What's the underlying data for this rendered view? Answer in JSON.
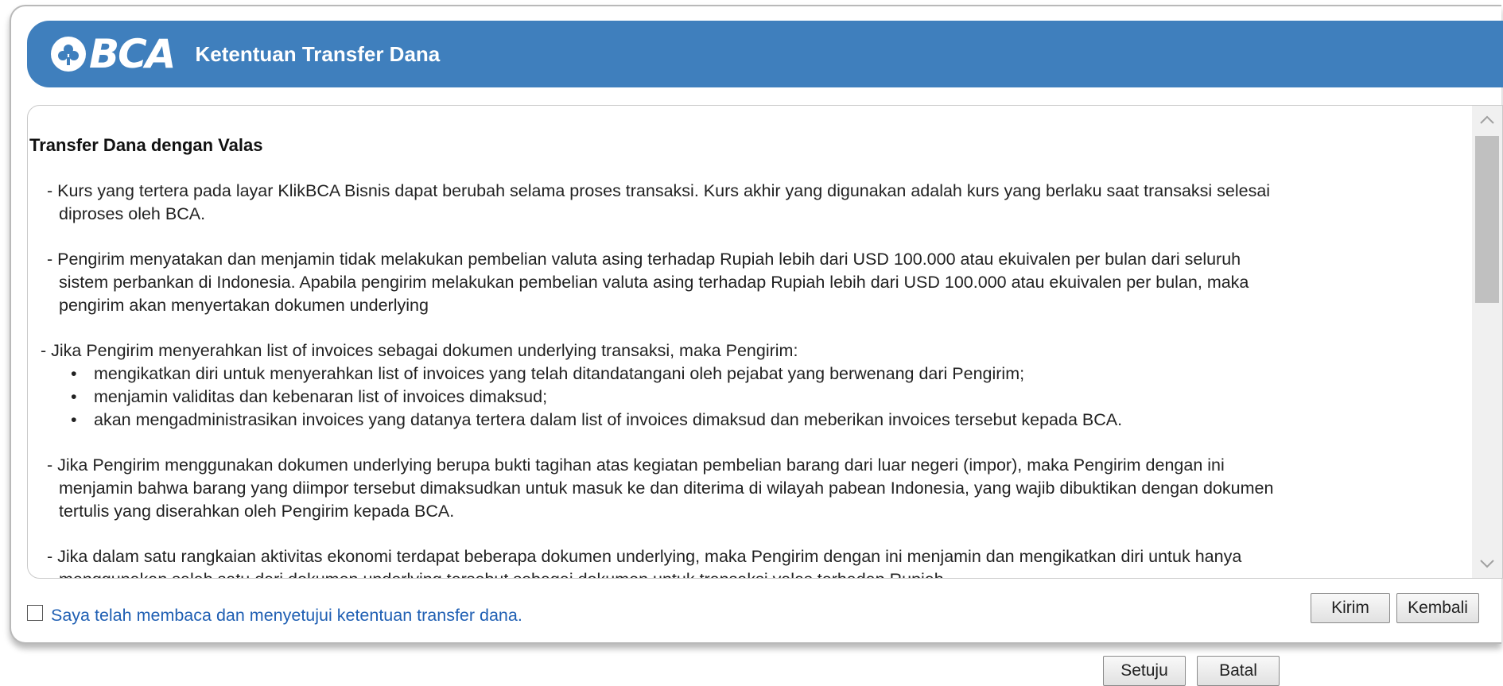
{
  "header": {
    "logo_text": "BCA",
    "title": "Ketentuan Transfer Dana",
    "background_color": "#3f7fbd"
  },
  "content": {
    "section_title": "Transfer Dana dengan Valas",
    "para1": [
      "- Kurs yang tertera pada layar KlikBCA Bisnis dapat berubah selama proses transaksi. Kurs akhir yang digunakan adalah kurs yang berlaku saat transaksi selesai",
      "diproses oleh BCA."
    ],
    "para2": [
      "- Pengirim menyatakan dan menjamin tidak melakukan pembelian valuta asing terhadap Rupiah lebih dari USD 100.000 atau ekuivalen per bulan dari seluruh",
      "sistem perbankan di Indonesia. Apabila pengirim melakukan pembelian valuta asing terhadap Rupiah lebih dari USD 100.000 atau ekuivalen per bulan, maka",
      "pengirim akan menyertakan dokumen underlying"
    ],
    "para3_intro": "- Jika Pengirim menyerahkan list of invoices sebagai dokumen underlying transaksi, maka Pengirim:",
    "para3_bullets": [
      "mengikatkan diri untuk menyerahkan list of invoices yang telah ditandatangani oleh pejabat yang berwenang dari Pengirim;",
      "menjamin validitas dan kebenaran list of invoices dimaksud;",
      "akan mengadministrasikan invoices yang datanya tertera dalam list of invoices dimaksud dan meberikan invoices tersebut kepada BCA."
    ],
    "para4": [
      "- Jika Pengirim menggunakan dokumen underlying berupa bukti tagihan atas kegiatan pembelian barang dari luar negeri (impor), maka Pengirim dengan ini",
      "menjamin bahwa barang yang diimpor tersebut dimaksudkan untuk masuk ke dan diterima di wilayah pabean Indonesia, yang wajib dibuktikan dengan dokumen",
      "tertulis yang diserahkan oleh Pengirim kepada BCA."
    ],
    "para5": [
      "- Jika dalam satu rangkaian aktivitas ekonomi terdapat beberapa dokumen underlying, maka Pengirim dengan ini menjamin dan mengikatkan diri untuk hanya",
      "menggunakan salah satu dari dokumen underlying tersebut sebagai dokumen untuk transaksi valas terhadap Rupiah."
    ]
  },
  "agreement": {
    "label": "Saya telah membaca dan menyetujui ketentuan transfer dana.",
    "checked": false
  },
  "buttons": {
    "kirim": "Kirim",
    "kembali": "Kembali",
    "setuju": "Setuju",
    "batal": "Batal"
  }
}
